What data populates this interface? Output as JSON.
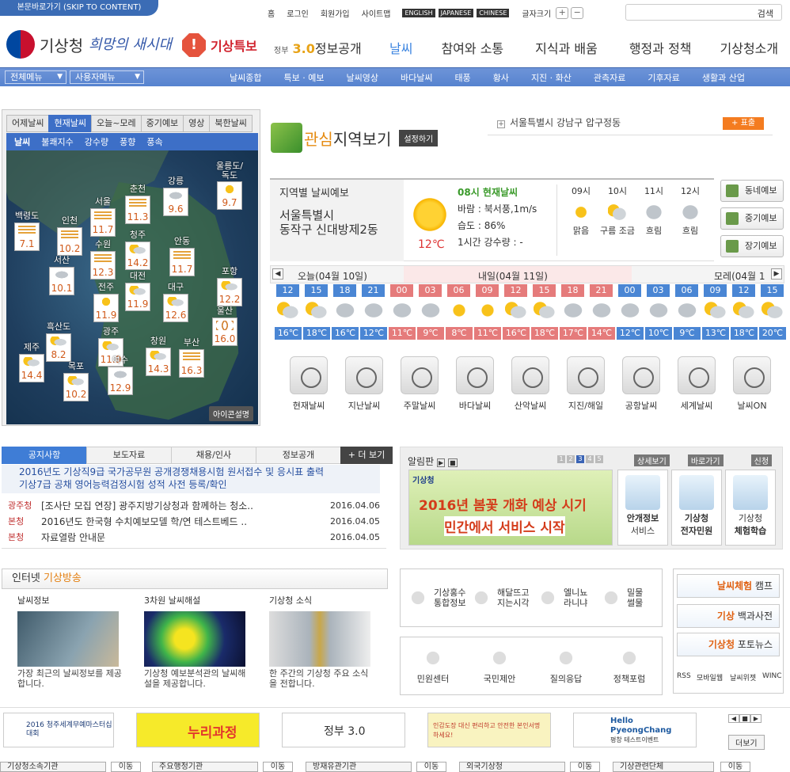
{
  "skip": "본문바로가기 (SKIP TO CONTENT)",
  "util": {
    "home": "홈",
    "login": "로그인",
    "join": "회원가입",
    "sitemap": "사이트맵",
    "en": "ENGLISH",
    "jp": "JAPANESE",
    "cn": "CHINESE",
    "fontsize": "글자크기",
    "plus": "+",
    "minus": "−",
    "search_btn": "검색"
  },
  "logo": {
    "name": "기상청",
    "slogan": "희망의 새시대"
  },
  "alert": {
    "label": "기상특보",
    "mark": "!"
  },
  "gov": {
    "prefix": "정부",
    "num": "3.0",
    "label": "정보공개"
  },
  "gnb": [
    "날씨",
    "참여와 소통",
    "지식과 배움",
    "행정과 정책",
    "기상청소개"
  ],
  "subnav": {
    "all": "전체메뉴",
    "user": "사용자메뉴",
    "items": [
      "날씨종합",
      "특보 · 예보",
      "날씨영상",
      "바다날씨",
      "태풍",
      "황사",
      "지진 · 화산",
      "관측자료",
      "기후자료",
      "생활과 산업"
    ]
  },
  "maptabs": [
    "어제날씨",
    "현재날씨",
    "오늘~모레",
    "중기예보",
    "영상",
    "북한날씨"
  ],
  "mapsub": [
    "날씨",
    "불쾌지수",
    "강수량",
    "풍향",
    "풍속"
  ],
  "icon_legend": "아이콘설명",
  "cities": [
    {
      "name": "울릉도/독도",
      "temp": "9.7",
      "icon": "sun"
    },
    {
      "name": "강릉",
      "temp": "9.6",
      "icon": "cd"
    },
    {
      "name": "춘천",
      "temp": "11.3",
      "icon": "fg"
    },
    {
      "name": "서울",
      "temp": "11.7",
      "icon": "fg"
    },
    {
      "name": "백령도",
      "temp": "7.1",
      "icon": "fg"
    },
    {
      "name": "인천",
      "temp": "10.2",
      "icon": "fg"
    },
    {
      "name": "수원",
      "temp": "12.3",
      "icon": "fg"
    },
    {
      "name": "청주",
      "temp": "14.2",
      "icon": "cl"
    },
    {
      "name": "안동",
      "temp": "11.7",
      "icon": "fg"
    },
    {
      "name": "서산",
      "temp": "10.1",
      "icon": "cd"
    },
    {
      "name": "대전",
      "temp": "11.9",
      "icon": "cl"
    },
    {
      "name": "포항",
      "temp": "12.2",
      "icon": "cl"
    },
    {
      "name": "전주",
      "temp": "11.9",
      "icon": "sun"
    },
    {
      "name": "대구",
      "temp": "12.6",
      "icon": "cl"
    },
    {
      "name": "울산",
      "temp": "16.0",
      "icon": "hz"
    },
    {
      "name": "흑산도",
      "temp": "8.2",
      "icon": "cl"
    },
    {
      "name": "광주",
      "temp": "11.9",
      "icon": "cl"
    },
    {
      "name": "창원",
      "temp": "14.3",
      "icon": "cl"
    },
    {
      "name": "부산",
      "temp": "16.3",
      "icon": "fg"
    },
    {
      "name": "제주",
      "temp": "14.4",
      "icon": "cl"
    },
    {
      "name": "목포",
      "temp": "10.2",
      "icon": "cl"
    },
    {
      "name": "여수",
      "temp": "12.9",
      "icon": "cd"
    }
  ],
  "interest": {
    "accent": "관심",
    "rest": "지역보기",
    "setting": "설정하기",
    "address": "서울특별시 강남구 압구정동",
    "show": "+ 표출"
  },
  "forecast": {
    "title": "지역별 날씨예보",
    "loc1": "서울특별시",
    "loc2": "동작구 신대방제2동",
    "current_time": "08시 현재날씨",
    "wind": "바람 : 북서풍,1m/s",
    "humidity": "습도 : 86%",
    "rain": "1시간 강수량 : -",
    "temp": "12℃",
    "hours": [
      {
        "h": "09시",
        "w": "맑음",
        "icon": "sun"
      },
      {
        "h": "10시",
        "w": "구름 조금",
        "icon": "cl"
      },
      {
        "h": "11시",
        "w": "흐림",
        "icon": "cd"
      },
      {
        "h": "12시",
        "w": "흐림",
        "icon": "cd"
      }
    ]
  },
  "sidebtns": [
    "동네예보",
    "중기예보",
    "장기예보"
  ],
  "timeline": {
    "today": "오늘(04월 10일)",
    "tomorrow": "내일(04월 11일)",
    "dayafter": "모레(04월 1",
    "cells": [
      {
        "h": "12",
        "t": "16℃",
        "d": 0
      },
      {
        "h": "15",
        "t": "18℃",
        "d": 0
      },
      {
        "h": "18",
        "t": "16℃",
        "d": 0
      },
      {
        "h": "21",
        "t": "12℃",
        "d": 0
      },
      {
        "h": "00",
        "t": "11℃",
        "d": 1
      },
      {
        "h": "03",
        "t": "9℃",
        "d": 1
      },
      {
        "h": "06",
        "t": "8℃",
        "d": 1
      },
      {
        "h": "09",
        "t": "11℃",
        "d": 1
      },
      {
        "h": "12",
        "t": "16℃",
        "d": 1
      },
      {
        "h": "15",
        "t": "18℃",
        "d": 1
      },
      {
        "h": "18",
        "t": "17℃",
        "d": 1
      },
      {
        "h": "21",
        "t": "14℃",
        "d": 1
      },
      {
        "h": "00",
        "t": "12℃",
        "d": 0
      },
      {
        "h": "03",
        "t": "10℃",
        "d": 0
      },
      {
        "h": "06",
        "t": "9℃",
        "d": 0
      },
      {
        "h": "09",
        "t": "13℃",
        "d": 0
      },
      {
        "h": "12",
        "t": "18℃",
        "d": 0
      },
      {
        "h": "15",
        "t": "20℃",
        "d": 0
      }
    ]
  },
  "services": [
    "현재날씨",
    "지난날씨",
    "주말날씨",
    "바다날씨",
    "산악날씨",
    "지진/해일",
    "공항날씨",
    "세계날씨",
    "날씨ON"
  ],
  "notice": {
    "tabs": [
      "공지사항",
      "보도자료",
      "채용/인사",
      "정보공개"
    ],
    "more": "+ 더 보기",
    "hl1": "2016년도 기상직9급 국가공무원 공개경쟁채용시험 원서접수 및 응시표 출력",
    "hl2": "기상7급 공채 영어능력검정시험 성적 사전 등록/확인",
    "items": [
      {
        "cat": "광주청",
        "title": "[조사단 모집 연장] 광주지방기상청과 함께하는 청소..",
        "date": "2016.04.06"
      },
      {
        "cat": "본청",
        "title": "2016년도 한국형 수치예보모델 학/연 테스트베드 ..",
        "date": "2016.04.05"
      },
      {
        "cat": "본청",
        "title": "자료열람 안내문",
        "date": "2016.04.05"
      }
    ]
  },
  "alim": {
    "title": "알림판",
    "pages": [
      "1",
      "2",
      "3",
      "4",
      "5"
    ],
    "detail": "상세보기",
    "goto": "바로가기",
    "apply": "신청",
    "banner_logo": "기상청",
    "banner1": "2016년 봄꽃 개화 예상 시기",
    "banner2": "민간에서 서비스 시작",
    "cards": [
      {
        "l1": "안개정보",
        "l2": "서비스"
      },
      {
        "l1": "기상청",
        "l2": "전자민원"
      },
      {
        "l1": "기상청",
        "l2": "체험학습"
      }
    ]
  },
  "broadcast": {
    "prefix": "인터넷 ",
    "accent": "기상방송",
    "cols": [
      {
        "t": "날씨정보",
        "d": "가장 최근의 날씨정보를 제공합니다."
      },
      {
        "t": "3차원 날씨해설",
        "d": "기상청 예보분석관의 날씨해설을 제공합니다."
      },
      {
        "t": "기상청 소식",
        "d": "한 주간의 기상청 주요 소식을 전합니다."
      }
    ]
  },
  "mid1": [
    {
      "a": "기상홍수",
      "b": "통합정보"
    },
    {
      "a": "해달뜨고",
      "b": "지는시각"
    },
    {
      "a": "엘니뇨",
      "b": "라니냐"
    },
    {
      "a": "밀물",
      "b": "썰물"
    }
  ],
  "mid2": [
    "민원센터",
    "국민제안",
    "질의응답",
    "정책포럼"
  ],
  "rightcards": [
    {
      "a": "날씨체험",
      "b": " 캠프"
    },
    {
      "a": "기상",
      "b": " 백과사전"
    },
    {
      "a": "기상청",
      "b": " 포토뉴스"
    }
  ],
  "rightsmall": [
    "RSS",
    "모바일웹",
    "날씨위젯",
    "WINC"
  ],
  "banners": {
    "b1": "2016 청주세계무예마스터십대회",
    "b2": "누리과정",
    "b3": "정부 3.0",
    "b4": "인감도장 대신 편리하고 안전한 본인서명 하세요!",
    "b5a": "Hello",
    "b5b": "PyeongChang",
    "b5c": "평창 테스트이벤트",
    "more": "더보기"
  },
  "selects": [
    {
      "label": "기상청소속기관",
      "go": "이동"
    },
    {
      "label": "주요행정기관",
      "go": "이동"
    },
    {
      "label": "방재유관기관",
      "go": "이동"
    },
    {
      "label": "외국기상청",
      "go": "이동"
    },
    {
      "label": "기상관련단체",
      "go": "이동"
    }
  ]
}
